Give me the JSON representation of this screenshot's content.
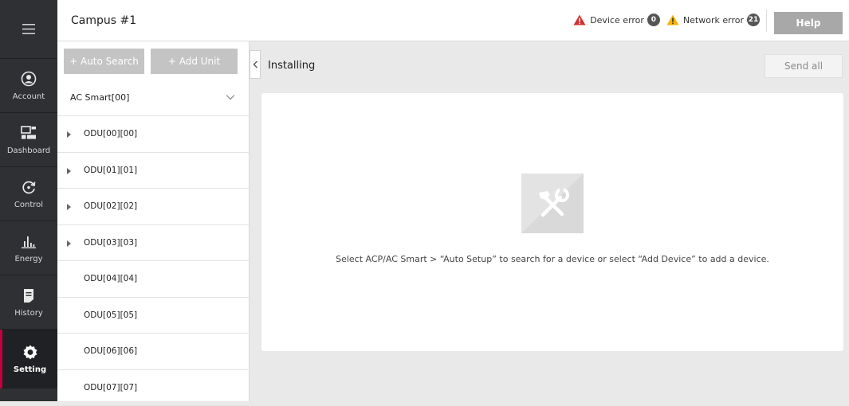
{
  "nav": {
    "items": [
      {
        "label": "Account",
        "icon": "account-icon"
      },
      {
        "label": "Dashboard",
        "icon": "dashboard-icon"
      },
      {
        "label": "Control",
        "icon": "control-icon"
      },
      {
        "label": "Energy",
        "icon": "energy-icon"
      },
      {
        "label": "History",
        "icon": "history-icon"
      },
      {
        "label": "Setting",
        "icon": "gear-icon"
      }
    ]
  },
  "header": {
    "title": "Campus #1",
    "device_error_label": "Device error",
    "device_error_count": "0",
    "network_error_label": "Network error",
    "network_error_count": "21",
    "help_label": "Help"
  },
  "tree": {
    "auto_search_label": "+ Auto Search",
    "add_unit_label": "+ Add Unit",
    "smart_label": "AC Smart[00]",
    "rows": [
      {
        "label": "ODU[00][00]",
        "expandable": true
      },
      {
        "label": "ODU[01][01]",
        "expandable": true
      },
      {
        "label": "ODU[02][02]",
        "expandable": true
      },
      {
        "label": "ODU[03][03]",
        "expandable": true
      },
      {
        "label": "ODU[04][04]",
        "expandable": false
      },
      {
        "label": "ODU[05][05]",
        "expandable": false
      },
      {
        "label": "ODU[06][06]",
        "expandable": false
      },
      {
        "label": "ODU[07][07]",
        "expandable": false
      }
    ]
  },
  "main": {
    "heading": "Installing",
    "send_all_label": "Send all",
    "empty_message": "Select ACP/AC Smart > “Auto Setup” to search for a device or select “Add Device” to add a device."
  },
  "colors": {
    "nav_bg": "#2f3033",
    "accent_active": "#c5003e",
    "error_red": "#d32f2f",
    "warning_yellow": "#f5b400"
  }
}
